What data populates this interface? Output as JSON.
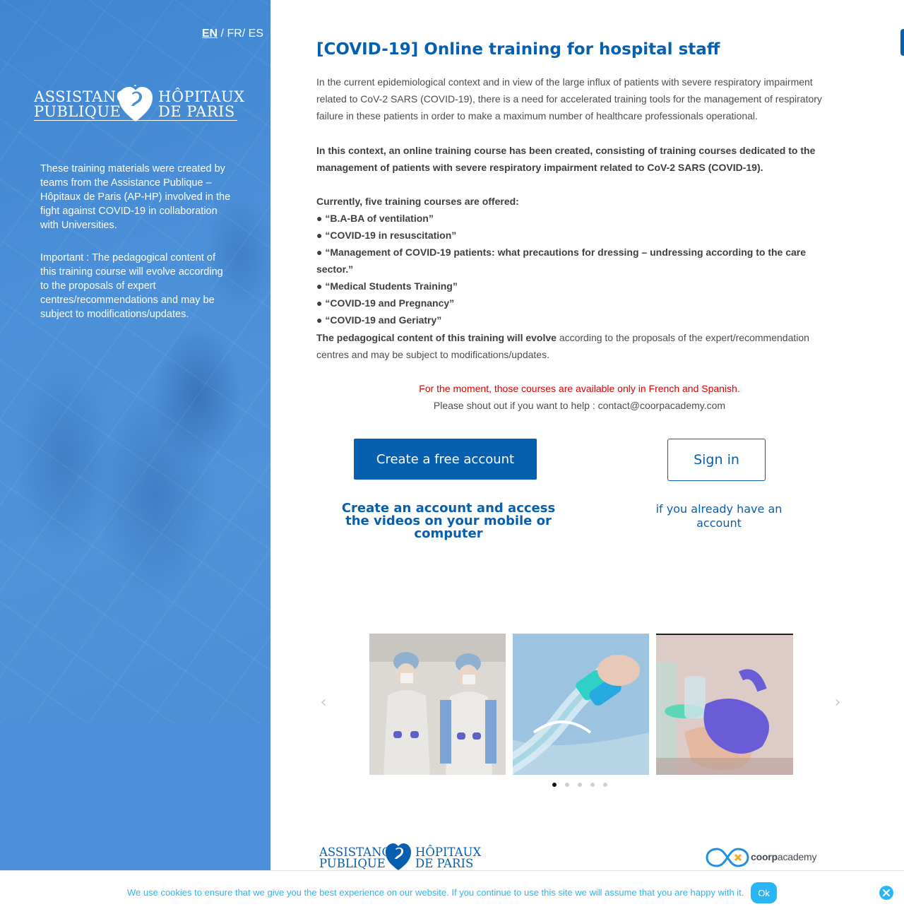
{
  "lang_switch": {
    "en": "EN",
    "sep1": " / ",
    "fr": "FR",
    "sep2": "/ ",
    "es": "ES"
  },
  "logo": {
    "line1_left": "ASSISTANCE",
    "line2_left": "PUBLIQUE",
    "line1_right": "HÔPITAUX",
    "line2_right": "DE  PARIS"
  },
  "left": {
    "p1": "These training materials were created by teams from the Assistance Publique – Hôpitaux de Paris (AP-HP) involved in the fight against COVID-19 in collaboration with Universities.",
    "p2": "Important : The pedagogical content of this training course will evolve according to the proposals of expert centres/recommendations and may be subject to modifications/updates."
  },
  "main": {
    "title": "[COVID-19] Online training for hospital staff",
    "intro": "In the current epidemiological context and in view of the large influx of patients with severe respiratory impairment related to CoV-2 SARS (COVID-19), there is a need for accelerated training tools for the management of respiratory failure in these patients in order to make a maximum number of healthcare professionals operational.",
    "context": "In this context, an online training course has been created, consisting of training courses dedicated to the management of patients with severe respiratory impairment related to CoV-2 SARS (COVID-19).",
    "list_heading": "Currently, five training courses are offered:",
    "courses": [
      "● “B.A-BA of ventilation”",
      "● “COVID-19 in resuscitation”",
      "● “Management of COVID-19 patients: what precautions for dressing – undressing according to the care sector.”",
      "● “Medical Students Training”",
      "● “COVID-19 and Pregnancy”",
      "● “COVID-19 and Geriatry”"
    ],
    "evolve_bold": "The pedagogical content of this training will evolve",
    "evolve_rest": " according to the proposals of the expert/recommendation centres and may be subject to modifications/updates.",
    "notice_red": "For the moment, those courses are available only in French and Spanish.",
    "notice_help": "Please shout out if you want to help : contact@coorpacademy.com"
  },
  "buttons": {
    "create": "Create a free account",
    "signin": "Sign in",
    "create_caption": "Create an account and access the videos on your mobile or computer",
    "signin_caption": "if you already have an account"
  },
  "carousel": {
    "prev": "‹",
    "next": "›",
    "slides": [
      "slide-1",
      "slide-2",
      "slide-3"
    ],
    "dots": 5,
    "active_dot": 0
  },
  "footer": {
    "aphp_line1_left": "ASSISTANCE",
    "aphp_line2_left": "PUBLIQUE",
    "aphp_line1_right": "HÔPITAUX",
    "aphp_line2_right": "DE  PARIS",
    "coorp_name_bold": "coorp",
    "coorp_name_rest": "academy"
  },
  "cookie": {
    "text": "We use cookies to ensure that we give you the best experience on our website. If you continue to use this site we will assume that you are happy with it.",
    "ok": "Ok"
  },
  "colors": {
    "brand_blue": "#075fb0",
    "panel_blue": "#4a8fd6",
    "notice_red": "#e00000",
    "cookie_blue": "#29b6f6"
  }
}
